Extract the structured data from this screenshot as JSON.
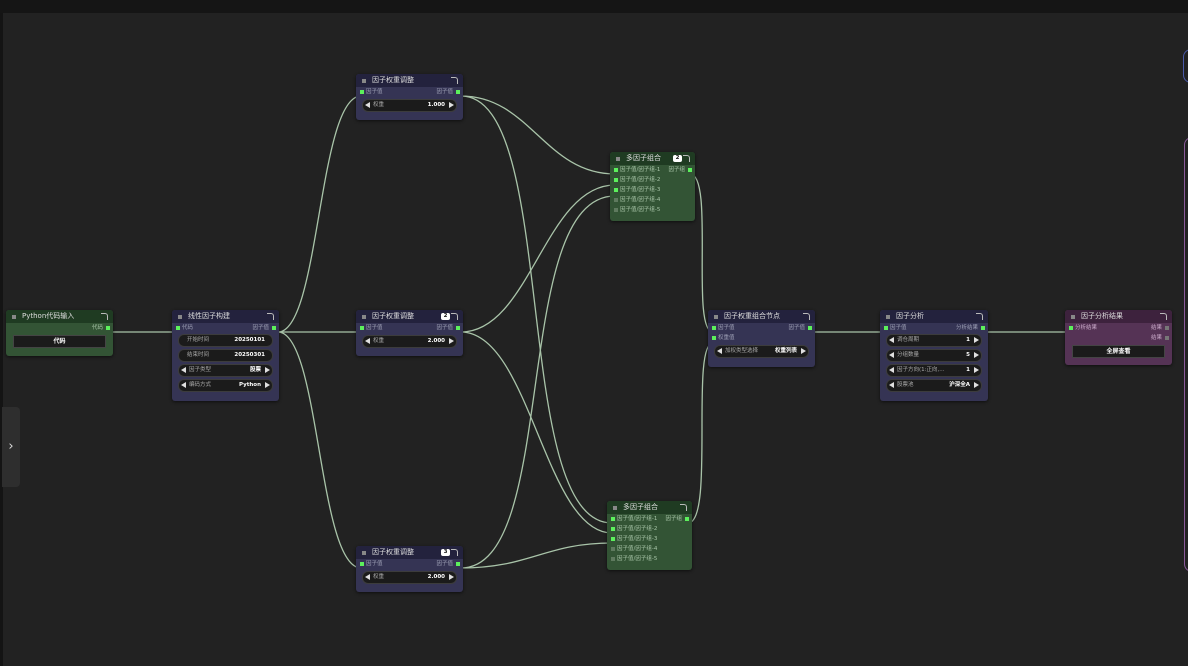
{
  "sidebar_toggle": {
    "glyph": "›"
  },
  "nodes": {
    "python_input": {
      "title": "Python代码输入",
      "out_label": "代码",
      "button": "代码"
    },
    "linear_factor": {
      "title": "线性因子构建",
      "in_label": "代码",
      "out_label": "因子值",
      "widgets": [
        {
          "label": "开始时间",
          "value": "20250101"
        },
        {
          "label": "结束时间",
          "value": "20250301"
        },
        {
          "label": "因子类型",
          "value": "股票"
        },
        {
          "label": "编码方式",
          "value": "Python"
        }
      ]
    },
    "weight_1": {
      "title": "因子权重调整",
      "in_label": "因子值",
      "out_label": "因子值",
      "widget": {
        "label": "权重",
        "value": "1.000"
      }
    },
    "weight_2": {
      "title": "因子权重调整",
      "badge": "2",
      "in_label": "因子值",
      "out_label": "因子值",
      "widget": {
        "label": "权重",
        "value": "2.000"
      }
    },
    "weight_3": {
      "title": "因子权重调整",
      "badge": "3",
      "in_label": "因子值",
      "out_label": "因子值",
      "widget": {
        "label": "权重",
        "value": "2.000"
      }
    },
    "combo_top": {
      "title": "多因子组合",
      "badge": "2",
      "out_label": "因子组",
      "inputs": [
        "因子值/因子组-1",
        "因子值/因子组-2",
        "因子值/因子组-3",
        "因子值/因子组-4",
        "因子值/因子组-5"
      ]
    },
    "combo_bottom": {
      "title": "多因子组合",
      "out_label": "因子组",
      "inputs": [
        "因子值/因子组-1",
        "因子值/因子组-2",
        "因子值/因子组-3",
        "因子值/因子组-4",
        "因子值/因子组-5"
      ]
    },
    "weight_combo": {
      "title": "因子权重组合节点",
      "inputs": [
        "因子值",
        "权重值"
      ],
      "out_label": "因子值",
      "widget": {
        "label": "加权类型选择",
        "value": "权重列表"
      }
    },
    "factor_analysis": {
      "title": "因子分析",
      "in_label": "因子值",
      "out_label": "分析结果",
      "widgets": [
        {
          "label": "调仓周期",
          "value": "1"
        },
        {
          "label": "分组数量",
          "value": "5"
        },
        {
          "label": "因子方向(1:正向,...",
          "value": "1"
        },
        {
          "label": "股票池",
          "value": "沪深全A"
        }
      ]
    },
    "analysis_result": {
      "title": "因子分析结果",
      "in_label": "分析结果",
      "outputs": [
        "结果",
        "结果"
      ],
      "button": "全屏查看"
    }
  }
}
